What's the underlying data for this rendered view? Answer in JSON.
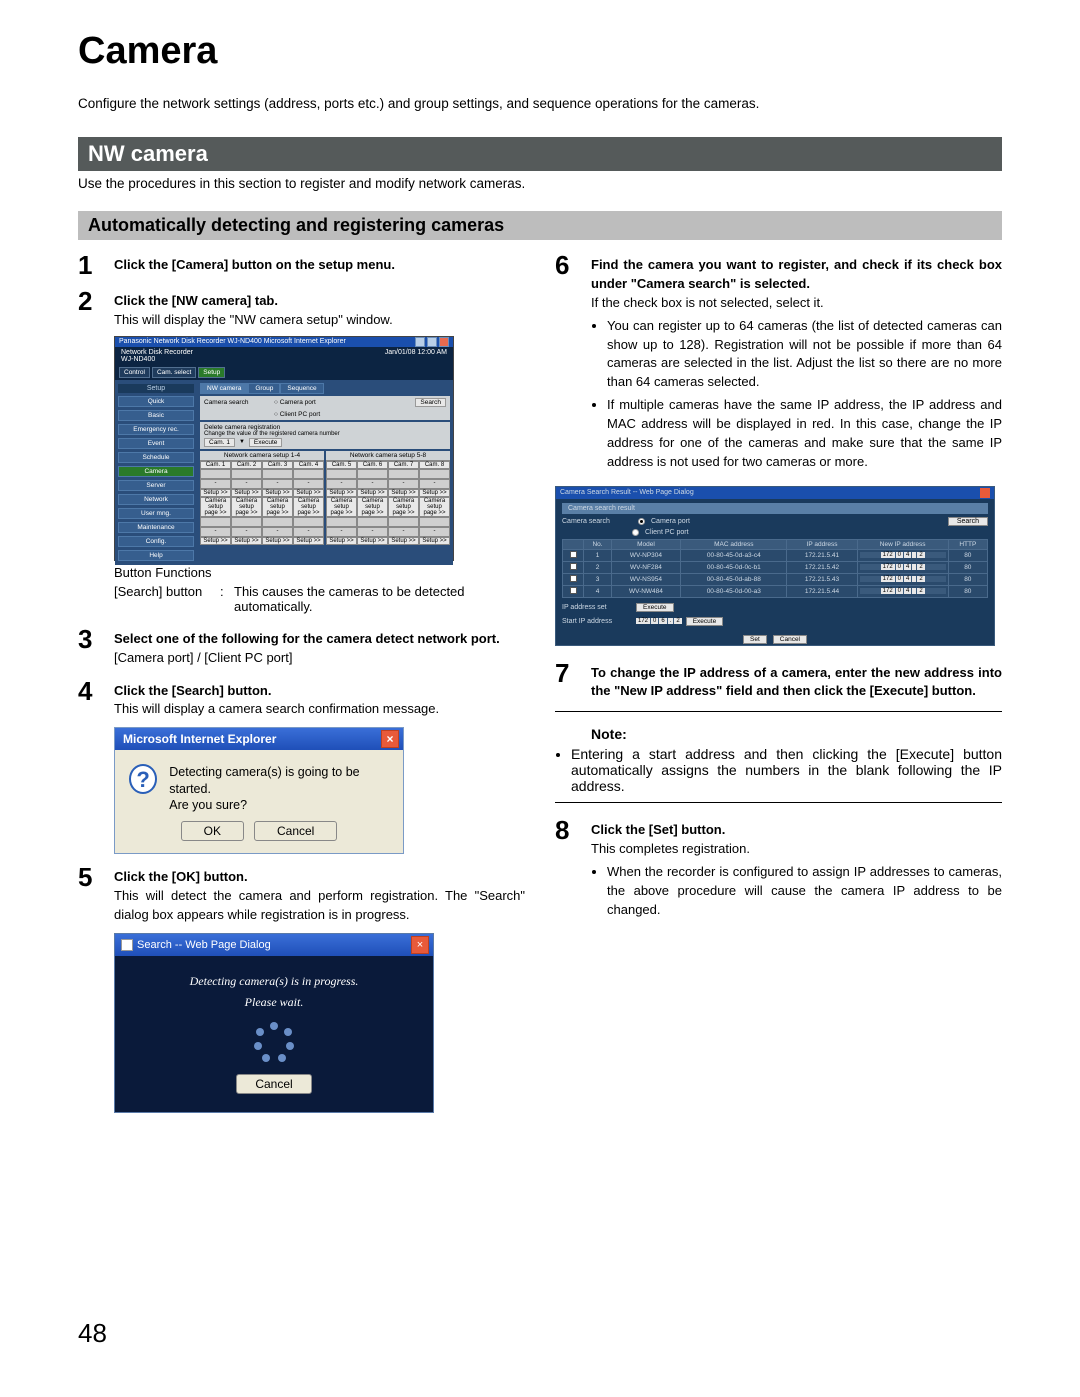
{
  "page": {
    "title": "Camera",
    "number": "48"
  },
  "intro": "Configure the network settings (address, ports etc.) and group settings, and sequence operations for the cameras.",
  "h2": "NW camera",
  "h2_desc": "Use the procedures in this section to register and modify network cameras.",
  "h3": "Automatically detecting and registering cameras",
  "steps": {
    "s1": {
      "n": "1",
      "bold": "Click the [Camera] button on the setup menu."
    },
    "s2": {
      "n": "2",
      "bold": "Click the [NW camera] tab.",
      "line1": "This will display the \"NW camera setup\" window."
    },
    "s3": {
      "n": "3",
      "bold": "Select one of the following for the camera detect network port.",
      "line1": "[Camera port] / [Client PC port]"
    },
    "s4": {
      "n": "4",
      "bold": "Click the [Search] button.",
      "line1": "This will display a camera search confirmation message."
    },
    "s5": {
      "n": "5",
      "bold": "Click the [OK] button.",
      "line1": "This will detect the camera and perform registration. The \"Search\" dialog box appears while registration is in progress."
    },
    "s6": {
      "n": "6",
      "bold": "Find the camera you want to register, and check if its check box under \"Camera search\" is selected.",
      "line1": "If the check box is not selected, select it.",
      "b1": "You can register up to 64 cameras (the list of detected cameras can show up to 128). Registration will not be possible if more than 64 cameras are selected in the list. Adjust the list so there are no more than 64 cameras selected.",
      "b2": "If multiple cameras have the same IP address, the IP address and MAC address will be displayed in red. In this case, change the IP address for one of the cameras and make sure that the same IP address is not used for two cameras or more."
    },
    "s7": {
      "n": "7",
      "bold": "To change the IP address of a camera, enter the new address into the \"New IP address\" field and then click the [Execute] button."
    },
    "s8": {
      "n": "8",
      "bold": "Click the [Set] button.",
      "line1": "This completes registration.",
      "b1": "When the recorder is configured to assign IP addresses to cameras, the above procedure will cause the camera IP address to be changed."
    }
  },
  "note": {
    "label": "Note:",
    "b1": "Entering a start address and then clicking the [Execute] button automatically assigns the numbers in the blank following the IP address."
  },
  "sshot1": {
    "titlebar": "Panasonic   Network Disk Recorder WJ-ND400   Microsoft Internet Explorer",
    "model": "Network Disk Recorder\nWJ-ND400",
    "clock": "Jan/01/08  12:00  AM",
    "top_tabs": [
      "Control",
      "Cam. select",
      "Setup"
    ],
    "setup_hdr": "Setup",
    "nav": [
      "Quick",
      "Basic",
      "Emergency rec.",
      "Event",
      "Schedule",
      "Camera",
      "Server",
      "Network",
      "User mng.",
      "Maintenance",
      "Config.",
      "Help"
    ],
    "right_tabs": [
      "NW camera",
      "Group",
      "Sequence"
    ],
    "search_lbl": "Camera search",
    "radio1": "Camera port",
    "radio2": "Client PC port",
    "search_btn": "Search",
    "del_lbl": "Delete camera registration",
    "del_hint": "Change the value of the registered camera number",
    "del_sel": "Cam. 1",
    "del_btn": "Execute",
    "grp_left": "Network camera setup 1-4",
    "grp_right": "Network camera setup 5-8",
    "cams_l": [
      "Cam. 1",
      "Cam. 2",
      "Cam. 3",
      "Cam. 4"
    ],
    "cams_r": [
      "Cam. 5",
      "Cam. 6",
      "Cam. 7",
      "Cam. 8"
    ],
    "setup_row": [
      "Setup >>",
      "Setup >>",
      "Setup >>",
      "Setup >>"
    ],
    "cs_row": [
      "Camera setup page >>",
      "Camera setup page >>",
      "Camera setup page >>",
      "Camera setup page >>"
    ]
  },
  "caption1": "Button Functions",
  "fnrow": {
    "lbl": "[Search] button",
    "colon": ":",
    "desc": "This causes the cameras to be detected automatically."
  },
  "sshot2": {
    "title": "Microsoft Internet Explorer",
    "msg1": "Detecting camera(s) is going to be started.",
    "msg2": "Are you sure?",
    "ok": "OK",
    "cancel": "Cancel"
  },
  "sshot3": {
    "title": "Search -- Web Page Dialog",
    "msg1": "Detecting camera(s) is in progress.",
    "msg2": "Please wait.",
    "cancel": "Cancel"
  },
  "sshot4": {
    "title": "Camera Search Result -- Web Page Dialog",
    "panel_hdr": "Camera search result",
    "srow_label": "Camera search",
    "radio1": "Camera port",
    "radio2": "Client PC port",
    "search_btn": "Search",
    "cols": [
      "No.",
      "Model",
      "MAC address",
      "IP address",
      "New IP address",
      "HTTP"
    ],
    "rows": [
      {
        "no": "1",
        "model": "WV-NP304",
        "mac": "00-80-45-0d-a3-c4",
        "ip": "172.21.5.41",
        "newip": [
          "172",
          "0",
          "4",
          "",
          "2"
        ],
        "http": "80"
      },
      {
        "no": "2",
        "model": "WV-NF284",
        "mac": "00-80-45-0d-0c-b1",
        "ip": "172.21.5.42",
        "newip": [
          "172",
          "0",
          "4",
          "",
          "2"
        ],
        "http": "80"
      },
      {
        "no": "3",
        "model": "WV-NS954",
        "mac": "00-80-45-0d-ab-88",
        "ip": "172.21.5.43",
        "newip": [
          "172",
          "0",
          "4",
          "",
          "2"
        ],
        "http": "80"
      },
      {
        "no": "4",
        "model": "WV-NW484",
        "mac": "00-80-45-0d-00-a3",
        "ip": "172.21.5.44",
        "newip": [
          "172",
          "0",
          "4",
          "",
          "2"
        ],
        "http": "80"
      }
    ],
    "ipaddr_lbl": "IP address set",
    "exec_btn": "Execute",
    "start_lbl": "Start IP address",
    "start_ip": [
      "172",
      "0",
      "6",
      ".",
      "2"
    ],
    "set": "Set",
    "cancel": "Cancel"
  }
}
